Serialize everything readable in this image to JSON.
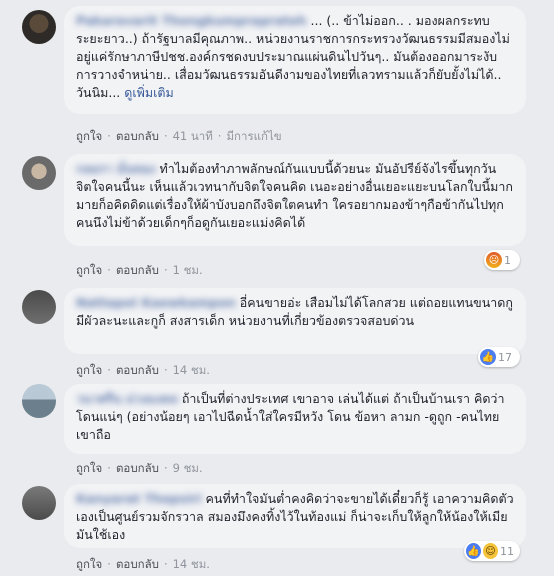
{
  "comments": [
    {
      "author": "Pakaravarit Thongkumpraprateh",
      "text": "... (.. ข้าไม่ออก.. . มองผลกระทบระยะยาว..) ถ้ารัฐบาลมีคุณภาพ.. หน่วยงานราชการกระทรวงวัฒนธรรมมีสมองไม่อยู่แค่รักษาภาษีปชช.องค์กรชดงบประมาณแผ่นดินไปวันๆ.. มันต้องออกมาระงับการวางจำหน่าย.. เสื่อมวัฒนธรรมอันดีงามของไทยที่เลวทรามแล้วก็ยับยั้งไม่ได้.. วันนิม...",
      "see_more": "ดูเพิ่มเติม",
      "like": "ถูกใจ",
      "reply": "ตอบกลับ",
      "time": "41 นาที",
      "edited": "มีการแก้ไข",
      "reaction_count": ""
    },
    {
      "author": "กลอรา มั่นทอง",
      "text": "ทำไมต้องทำภาพลักษณ์กันแบบนี้ด้วยนะ มันอัปรีย์จังไรขึ้นทุกวันจิตใจคนนี้นะ เห็นแล้วเวทนากับจิตใจคนคิด เนอะอย่างอื่นเยอะแยะบนโลกใบนี้มากมายก็อคิดดิดแต่เรื่องให้ผ้าบังบอกถึงจิตใตคนทำ ใครอยากมองข้าๆกือข้ากันไปทุกคนนึงไม่ข้าด้วยเด็กๆก็อดูกันเยอะแม่งคิดได้",
      "like": "ถูกใจ",
      "reply": "ตอบกลับ",
      "time": "1 ชม.",
      "reaction_count": "1"
    },
    {
      "author": "Nattapol Kaewkampon",
      "text": "อี่คนขายอ่ะ เสือมไม่ได้โลกสวย แต่ถอยแทนขนาดกูมีผัวละนะและกูก็ สงสารเด็ก หน่วยงานที่เกี่ยวข้องตรวจสอบด่วน",
      "like": "ถูกใจ",
      "reply": "ตอบกลับ",
      "time": "14 ชม.",
      "reaction_count": "17"
    },
    {
      "author": "วนาศรีน ม่วงมงคล",
      "text": "ถ้าเป็นที่ต่างประเทศ เขาอาจ เล่นได้แต่ ถ้าเป็นบ้านเรา คิดว่า โดนแน่ๆ (อย่างน้อยๆ เอาไปฉีดน้ำใส่ใครมีหวัง โดน ข้อหา ลามก -ดูถูก -คนไทยเขาถือ",
      "like": "ถูกใจ",
      "reply": "ตอบกลับ",
      "time": "9 ชม.",
      "reaction_count": ""
    },
    {
      "author": "Kanyarat Thepsiri",
      "text": "คนที่ทำใจมันต่ำคงคิดว่าจะขายได้เดี๋ยวก็รู้ เอาความคิดตัวเองเป็นศูนย์รวมจักรวาล สมองมึงคงทิ้งไว้ในท้องแม่ ก็น่าจะเก็บให้ลูกให้น้องให้เมียมันใช้เอง",
      "like": "ถูกใจ",
      "reply": "ตอบกลับ",
      "time": "14 ชม.",
      "reaction_count": "11"
    }
  ],
  "colors": {
    "background": "#e9ebee",
    "bubble": "#f2f3f5",
    "link": "#365899",
    "meta": "#90949c"
  },
  "icons": [
    "angry-reaction-icon",
    "like-reaction-icon",
    "wow-reaction-icon"
  ]
}
